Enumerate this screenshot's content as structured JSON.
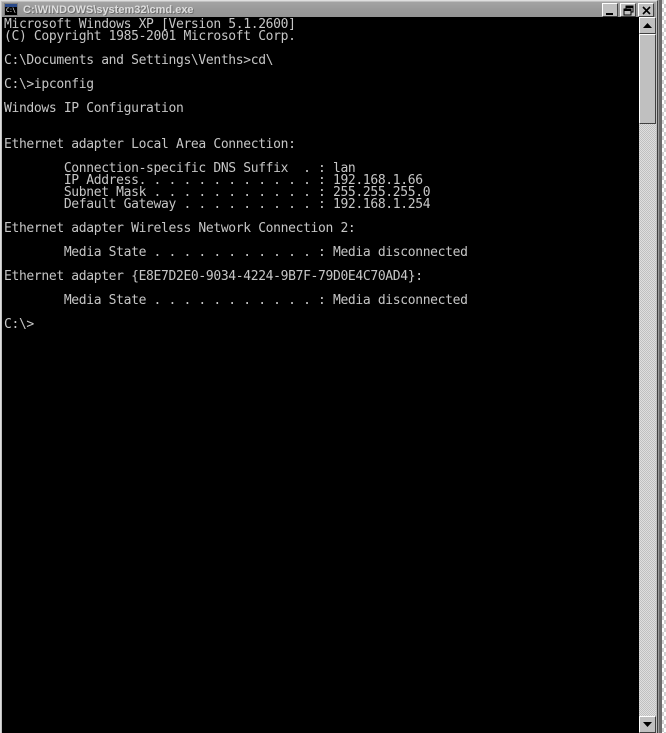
{
  "window": {
    "title": "C:\\WINDOWS\\system32\\cmd.exe",
    "icon": "cmd-console-icon",
    "icon_label": "C:\\",
    "state": "inactive",
    "titlebar_color": "#9a9a9a",
    "console_bg": "#000000",
    "console_fg": "#c6c6c6",
    "controls": {
      "minimize": "Minimize",
      "restore": "Restore",
      "close": "Close"
    }
  },
  "scrollbar": {
    "up_arrow": "Scroll up",
    "down_arrow": "Scroll down",
    "thumb": "Scroll thumb"
  },
  "console": {
    "lines": [
      "Microsoft Windows XP [Version 5.1.2600]",
      "(C) Copyright 1985-2001 Microsoft Corp.",
      "",
      "C:\\Documents and Settings\\Venths>cd\\",
      "",
      "C:\\>ipconfig",
      "",
      "Windows IP Configuration",
      "",
      "",
      "Ethernet adapter Local Area Connection:",
      "",
      "        Connection-specific DNS Suffix  . : lan",
      "        IP Address. . . . . . . . . . . . : 192.168.1.66",
      "        Subnet Mask . . . . . . . . . . . : 255.255.255.0",
      "        Default Gateway . . . . . . . . . : 192.168.1.254",
      "",
      "Ethernet adapter Wireless Network Connection 2:",
      "",
      "        Media State . . . . . . . . . . . : Media disconnected",
      "",
      "Ethernet adapter {E8E7D2E0-9034-4224-9B7F-79D0E4C70AD4}:",
      "",
      "        Media State . . . . . . . . . . . : Media disconnected",
      "",
      "C:\\>"
    ],
    "details": {
      "os_name": "Microsoft Windows XP",
      "os_version": "Version 5.1.2600",
      "copyright": "(C) Copyright 1985-2001 Microsoft Corp.",
      "user_profile_path": "C:\\Documents and Settings\\Venths",
      "commands_run": [
        "cd\\",
        "ipconfig"
      ],
      "current_prompt": "C:\\>",
      "section_title": "Windows IP Configuration",
      "adapters": [
        {
          "name": "Ethernet adapter Local Area Connection:",
          "fields": [
            {
              "label": "Connection-specific DNS Suffix  .",
              "value": "lan"
            },
            {
              "label": "IP Address. . . . . . . . . . . .",
              "value": "192.168.1.66"
            },
            {
              "label": "Subnet Mask . . . . . . . . . . .",
              "value": "255.255.255.0"
            },
            {
              "label": "Default Gateway . . . . . . . . .",
              "value": "192.168.1.254"
            }
          ]
        },
        {
          "name": "Ethernet adapter Wireless Network Connection 2:",
          "fields": [
            {
              "label": "Media State . . . . . . . . . . .",
              "value": "Media disconnected"
            }
          ]
        },
        {
          "name": "Ethernet adapter {E8E7D2E0-9034-4224-9B7F-79D0E4C70AD4}:",
          "fields": [
            {
              "label": "Media State . . . . . . . . . . .",
              "value": "Media disconnected"
            }
          ]
        }
      ]
    }
  }
}
